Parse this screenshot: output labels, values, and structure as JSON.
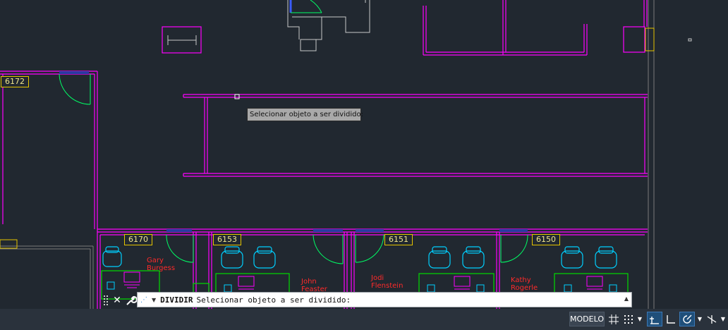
{
  "rooms": [
    {
      "number": "6172"
    },
    {
      "number": "6170"
    },
    {
      "number": "6153"
    },
    {
      "number": "6151"
    },
    {
      "number": "6150"
    }
  ],
  "occupants": [
    {
      "first": "Gary",
      "last": "Burgess"
    },
    {
      "first": "John",
      "last": "Feaster"
    },
    {
      "first": "Jodi",
      "last": "Flenstein"
    },
    {
      "first": "Kathy",
      "last": "Rogerle"
    }
  ],
  "tooltip": {
    "text": "Selecionar objeto a ser dividido:"
  },
  "command_line": {
    "command": "DIVIDIR",
    "prompt": "Selecionar objeto a ser dividido:"
  },
  "statusbar": {
    "model_tab": "MODELO",
    "buttons": [
      {
        "icon": "grid-icon",
        "active": false
      },
      {
        "icon": "snap-icon",
        "active": false
      },
      {
        "icon": "snap-dropdown-icon",
        "active": false
      },
      {
        "icon": "infer-constraints-icon",
        "active": true
      },
      {
        "icon": "ortho-icon",
        "active": false
      },
      {
        "icon": "polar-tracking-icon",
        "active": true
      },
      {
        "icon": "polar-dropdown-icon",
        "active": false
      },
      {
        "icon": "isometric-icon",
        "active": false
      },
      {
        "icon": "isometric-dropdown-icon",
        "active": false
      }
    ]
  },
  "colors": {
    "background": "#212830",
    "wall": "#ff00ff",
    "furniture": "#00d0ff",
    "desk": "#00dd00",
    "tag_border": "#e5c400",
    "occupant_text": "#ff2a2a",
    "door": "#00ff66",
    "accent_active": "#3a78b6"
  }
}
